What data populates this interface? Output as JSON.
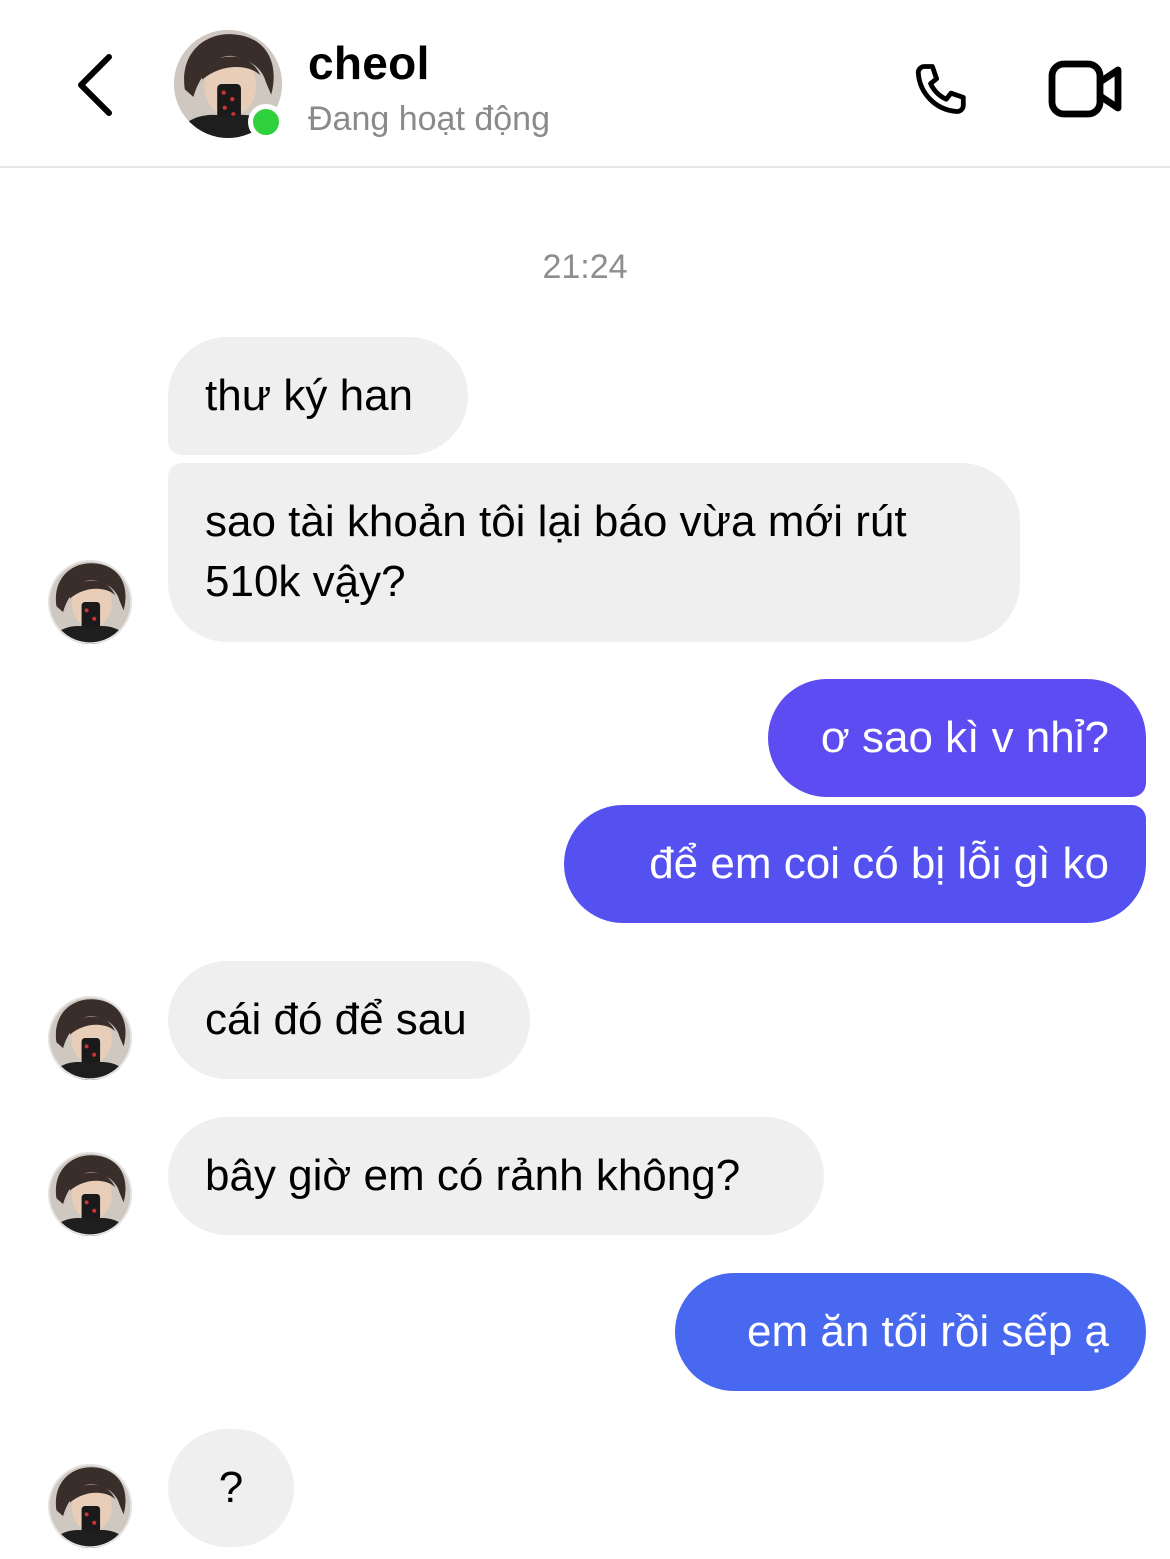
{
  "header": {
    "contact_name": "cheol",
    "status": "Đang hoạt động",
    "icons": {
      "back": "chevron-left-icon",
      "call": "phone-icon",
      "video": "video-camera-icon"
    },
    "online_color": "#2fd13d"
  },
  "conversation": {
    "timestamp": "21:24",
    "messages": [
      {
        "sender": "contact",
        "text": "thư ký han"
      },
      {
        "sender": "contact",
        "text_lines": [
          "sao tài khoản tôi lại báo vừa mới rút",
          "510k vậy?"
        ]
      },
      {
        "sender": "me",
        "text": "ơ sao kì v nhỉ?"
      },
      {
        "sender": "me",
        "text": "để em coi có bị lỗi gì ko"
      },
      {
        "sender": "contact",
        "text": "cái đó để sau"
      },
      {
        "sender": "contact",
        "text": "bây giờ em có rảnh không?"
      },
      {
        "sender": "me",
        "text": "em ăn tối rồi sếp ạ"
      },
      {
        "sender": "contact",
        "text": "?"
      }
    ]
  },
  "colors": {
    "incoming_bubble": "#efefef",
    "outgoing_purple": "#5c4cf1",
    "outgoing_indigo": "#5551f1",
    "outgoing_blue": "#4868f0",
    "status_text": "#8a8a8a"
  }
}
